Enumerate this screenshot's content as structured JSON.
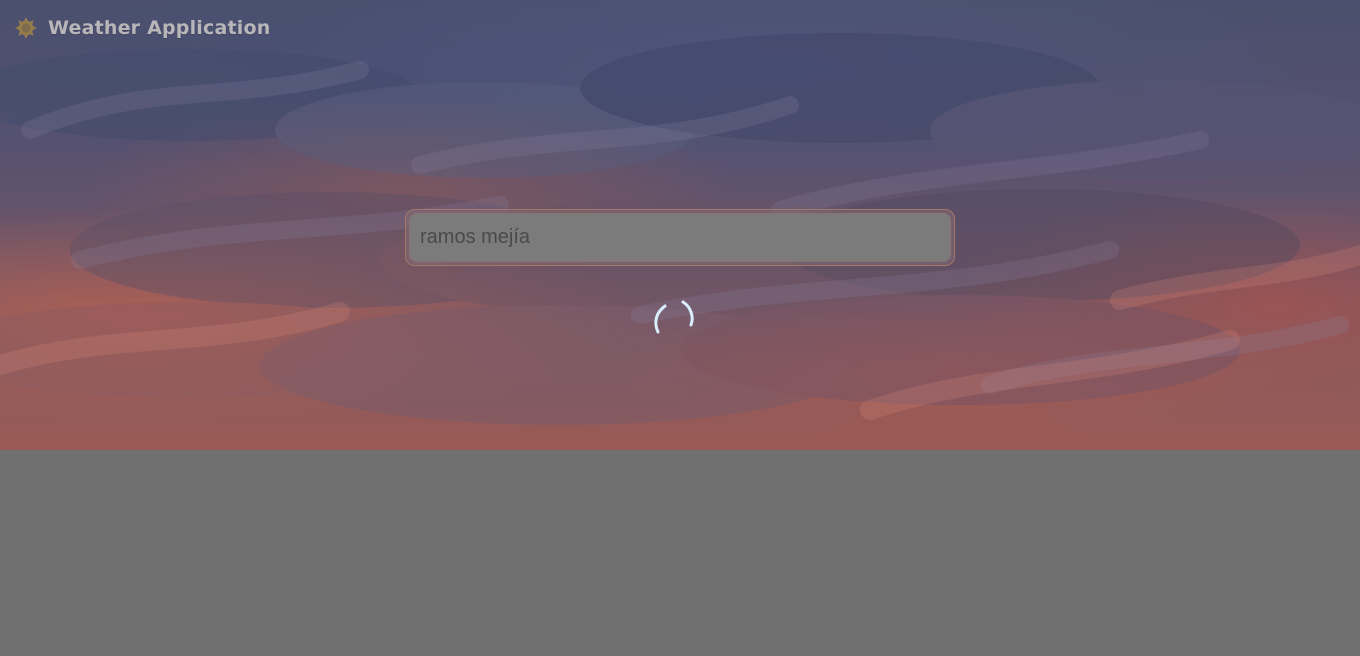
{
  "header": {
    "app_title": "Weather Application",
    "brand_icon": "sun-icon"
  },
  "search": {
    "value": "ramos mejía",
    "placeholder": ""
  },
  "status": {
    "loading_icon": "loading-spinner-icon"
  },
  "colors": {
    "overlay_gray": "#707071",
    "spinner": "#cfe7ff",
    "input_border": "#a7796c"
  }
}
